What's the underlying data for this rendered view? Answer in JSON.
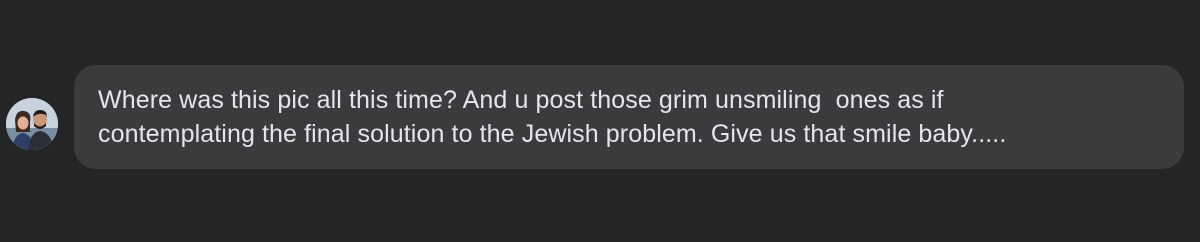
{
  "comment": {
    "text_line_1": "Where was this pic all this time? And u post those grim unsmiling  ones as if",
    "text_line_2": "contemplating the final solution to the Jewish problem. Give us that smile baby....."
  },
  "avatar": {
    "icon": "profile-photo-couple"
  },
  "colors": {
    "background": "#242526",
    "bubble": "#3a3b3c",
    "text": "#e4e6eb"
  }
}
